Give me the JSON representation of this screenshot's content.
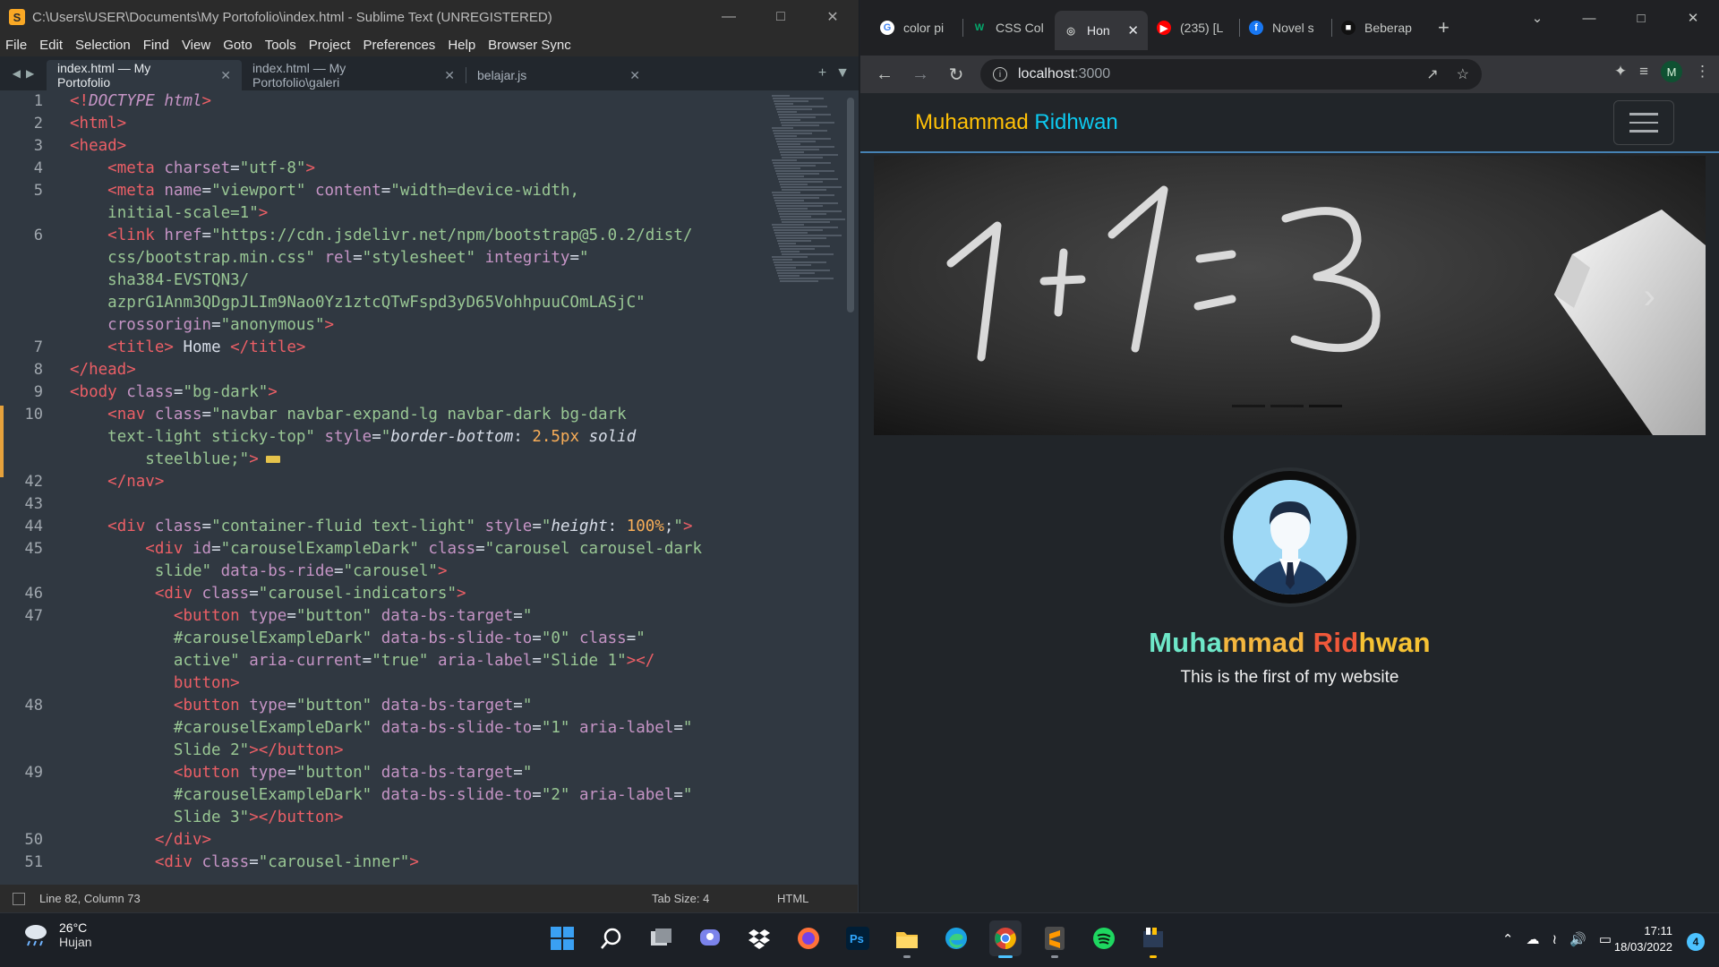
{
  "sublime": {
    "title": "C:\\Users\\USER\\Documents\\My Portofolio\\index.html - Sublime Text (UNREGISTERED)",
    "menu": [
      "File",
      "Edit",
      "Selection",
      "Find",
      "View",
      "Goto",
      "Tools",
      "Project",
      "Preferences",
      "Help",
      "Browser Sync"
    ],
    "tabs": [
      {
        "label": "index.html — My Portofolio"
      },
      {
        "label": "index.html — My Portofolio\\galeri"
      },
      {
        "label": "belajar.js"
      }
    ],
    "line_numbers": [
      "1",
      "2",
      "3",
      "4",
      "5",
      "",
      "6",
      "",
      "",
      "",
      "",
      "7",
      "8",
      "9",
      "10",
      "",
      "",
      "42",
      "43",
      "44",
      "45",
      "",
      "46",
      "47",
      "",
      "",
      "",
      "48",
      "",
      "",
      "49",
      "",
      "",
      "50",
      "51"
    ],
    "lines": [
      {
        "parts": [
          [
            "tg",
            "<!"
          ],
          [
            "kw",
            "DOCTYPE"
          ],
          [
            "tg",
            " "
          ],
          [
            "kw",
            "html"
          ],
          [
            "tg",
            ">"
          ]
        ]
      },
      {
        "parts": [
          [
            "tg",
            "<html>"
          ]
        ]
      },
      {
        "parts": [
          [
            "tg",
            "<head>"
          ]
        ]
      },
      {
        "parts": [
          [
            "pad",
            "    "
          ],
          [
            "tg",
            "<meta "
          ],
          [
            "at",
            "charset"
          ],
          [
            "eq",
            "="
          ],
          [
            "st",
            "\"utf-8\""
          ],
          [
            "tg",
            ">"
          ]
        ]
      },
      {
        "parts": [
          [
            "pad",
            "    "
          ],
          [
            "tg",
            "<meta "
          ],
          [
            "at",
            "name"
          ],
          [
            "eq",
            "="
          ],
          [
            "st",
            "\"viewport\""
          ],
          [
            "eq",
            " "
          ],
          [
            "at",
            "content"
          ],
          [
            "eq",
            "="
          ],
          [
            "st",
            "\"width=device-width,"
          ]
        ]
      },
      {
        "parts": [
          [
            "pad",
            "    "
          ],
          [
            "st",
            "initial-scale=1\""
          ],
          [
            "tg",
            ">"
          ]
        ]
      },
      {
        "parts": [
          [
            "pad",
            "    "
          ],
          [
            "tg",
            "<link "
          ],
          [
            "at",
            "href"
          ],
          [
            "eq",
            "="
          ],
          [
            "st",
            "\"https://cdn.jsdelivr.net/npm/bootstrap@5.0.2/dist/"
          ]
        ]
      },
      {
        "parts": [
          [
            "pad",
            "    "
          ],
          [
            "st",
            "css/bootstrap.min.css\""
          ],
          [
            "eq",
            " "
          ],
          [
            "at",
            "rel"
          ],
          [
            "eq",
            "="
          ],
          [
            "st",
            "\"stylesheet\""
          ],
          [
            "eq",
            " "
          ],
          [
            "at",
            "integrity"
          ],
          [
            "eq",
            "="
          ],
          [
            "st",
            "\""
          ]
        ]
      },
      {
        "parts": [
          [
            "pad",
            "    "
          ],
          [
            "st",
            "sha384-EVSTQN3/"
          ]
        ]
      },
      {
        "parts": [
          [
            "pad",
            "    "
          ],
          [
            "st",
            "azprG1Anm3QDgpJLIm9Nao0Yz1ztcQTwFspd3yD65VohhpuuCOmLASjC\""
          ]
        ]
      },
      {
        "parts": [
          [
            "pad",
            "    "
          ],
          [
            "at",
            "crossorigin"
          ],
          [
            "eq",
            "="
          ],
          [
            "st",
            "\"anonymous\""
          ],
          [
            "tg",
            ">"
          ]
        ]
      },
      {
        "parts": [
          [
            "pad",
            "    "
          ],
          [
            "tg",
            "<title>"
          ],
          [
            "eq",
            " Home "
          ],
          [
            "tg",
            "</title>"
          ]
        ]
      },
      {
        "parts": [
          [
            "tg",
            "</head>"
          ]
        ]
      },
      {
        "parts": [
          [
            "tg",
            "<body "
          ],
          [
            "at",
            "class"
          ],
          [
            "eq",
            "="
          ],
          [
            "st",
            "\"bg-dark\""
          ],
          [
            "tg",
            ">"
          ]
        ]
      },
      {
        "parts": [
          [
            "pad",
            "    "
          ],
          [
            "tg",
            "<nav "
          ],
          [
            "at",
            "class"
          ],
          [
            "eq",
            "="
          ],
          [
            "st",
            "\"navbar navbar-expand-lg navbar-dark bg-dark"
          ]
        ]
      },
      {
        "parts": [
          [
            "pad",
            "    "
          ],
          [
            "st",
            "text-light sticky-top\""
          ],
          [
            "eq",
            " "
          ],
          [
            "at",
            "style"
          ],
          [
            "eq",
            "="
          ],
          [
            "st",
            "\""
          ],
          [
            "prop",
            "border-bottom"
          ],
          [
            "eq",
            ": "
          ],
          [
            "num",
            "2.5px"
          ],
          [
            "eq",
            " "
          ],
          [
            "prop",
            "solid"
          ]
        ]
      },
      {
        "parts": [
          [
            "pad",
            "        "
          ],
          [
            "st",
            "steelblue;\""
          ],
          [
            "tg",
            ">"
          ],
          [
            "fold",
            ""
          ]
        ]
      },
      {
        "parts": [
          [
            "pad",
            "    "
          ],
          [
            "tg",
            "</nav>"
          ]
        ]
      },
      {
        "parts": []
      },
      {
        "parts": [
          [
            "pad",
            "    "
          ],
          [
            "tg",
            "<div "
          ],
          [
            "at",
            "class"
          ],
          [
            "eq",
            "="
          ],
          [
            "st",
            "\"container-fluid text-light\""
          ],
          [
            "eq",
            " "
          ],
          [
            "at",
            "style"
          ],
          [
            "eq",
            "="
          ],
          [
            "st",
            "\""
          ],
          [
            "prop",
            "height"
          ],
          [
            "eq",
            ": "
          ],
          [
            "num",
            "100%"
          ],
          [
            "eq",
            ";"
          ],
          [
            "st",
            "\""
          ],
          [
            "tg",
            ">"
          ]
        ]
      },
      {
        "parts": [
          [
            "pad",
            "        "
          ],
          [
            "tg",
            "<div "
          ],
          [
            "at",
            "id"
          ],
          [
            "eq",
            "="
          ],
          [
            "st",
            "\"carouselExampleDark\""
          ],
          [
            "eq",
            " "
          ],
          [
            "at",
            "class"
          ],
          [
            "eq",
            "="
          ],
          [
            "st",
            "\"carousel carousel-dark"
          ]
        ]
      },
      {
        "parts": [
          [
            "pad",
            "         "
          ],
          [
            "st",
            "slide\""
          ],
          [
            "eq",
            " "
          ],
          [
            "at",
            "data-bs-ride"
          ],
          [
            "eq",
            "="
          ],
          [
            "st",
            "\"carousel\""
          ],
          [
            "tg",
            ">"
          ]
        ]
      },
      {
        "parts": [
          [
            "pad",
            "         "
          ],
          [
            "tg",
            "<div "
          ],
          [
            "at",
            "class"
          ],
          [
            "eq",
            "="
          ],
          [
            "st",
            "\"carousel-indicators\""
          ],
          [
            "tg",
            ">"
          ]
        ]
      },
      {
        "parts": [
          [
            "pad",
            "           "
          ],
          [
            "tg",
            "<button "
          ],
          [
            "at",
            "type"
          ],
          [
            "eq",
            "="
          ],
          [
            "st",
            "\"button\""
          ],
          [
            "eq",
            " "
          ],
          [
            "at",
            "data-bs-target"
          ],
          [
            "eq",
            "="
          ],
          [
            "st",
            "\""
          ]
        ]
      },
      {
        "parts": [
          [
            "pad",
            "           "
          ],
          [
            "st",
            "#carouselExampleDark\""
          ],
          [
            "eq",
            " "
          ],
          [
            "at",
            "data-bs-slide-to"
          ],
          [
            "eq",
            "="
          ],
          [
            "st",
            "\"0\""
          ],
          [
            "eq",
            " "
          ],
          [
            "at",
            "class"
          ],
          [
            "eq",
            "="
          ],
          [
            "st",
            "\""
          ]
        ]
      },
      {
        "parts": [
          [
            "pad",
            "           "
          ],
          [
            "st",
            "active\""
          ],
          [
            "eq",
            " "
          ],
          [
            "at",
            "aria-current"
          ],
          [
            "eq",
            "="
          ],
          [
            "st",
            "\"true\""
          ],
          [
            "eq",
            " "
          ],
          [
            "at",
            "aria-label"
          ],
          [
            "eq",
            "="
          ],
          [
            "st",
            "\"Slide 1\""
          ],
          [
            "tg",
            "></"
          ]
        ]
      },
      {
        "parts": [
          [
            "pad",
            "           "
          ],
          [
            "tg",
            "button>"
          ]
        ]
      },
      {
        "parts": [
          [
            "pad",
            "           "
          ],
          [
            "tg",
            "<button "
          ],
          [
            "at",
            "type"
          ],
          [
            "eq",
            "="
          ],
          [
            "st",
            "\"button\""
          ],
          [
            "eq",
            " "
          ],
          [
            "at",
            "data-bs-target"
          ],
          [
            "eq",
            "="
          ],
          [
            "st",
            "\""
          ]
        ]
      },
      {
        "parts": [
          [
            "pad",
            "           "
          ],
          [
            "st",
            "#carouselExampleDark\""
          ],
          [
            "eq",
            " "
          ],
          [
            "at",
            "data-bs-slide-to"
          ],
          [
            "eq",
            "="
          ],
          [
            "st",
            "\"1\""
          ],
          [
            "eq",
            " "
          ],
          [
            "at",
            "aria-label"
          ],
          [
            "eq",
            "="
          ],
          [
            "st",
            "\""
          ]
        ]
      },
      {
        "parts": [
          [
            "pad",
            "           "
          ],
          [
            "st",
            "Slide 2\""
          ],
          [
            "tg",
            "></button>"
          ]
        ]
      },
      {
        "parts": [
          [
            "pad",
            "           "
          ],
          [
            "tg",
            "<button "
          ],
          [
            "at",
            "type"
          ],
          [
            "eq",
            "="
          ],
          [
            "st",
            "\"button\""
          ],
          [
            "eq",
            " "
          ],
          [
            "at",
            "data-bs-target"
          ],
          [
            "eq",
            "="
          ],
          [
            "st",
            "\""
          ]
        ]
      },
      {
        "parts": [
          [
            "pad",
            "           "
          ],
          [
            "st",
            "#carouselExampleDark\""
          ],
          [
            "eq",
            " "
          ],
          [
            "at",
            "data-bs-slide-to"
          ],
          [
            "eq",
            "="
          ],
          [
            "st",
            "\"2\""
          ],
          [
            "eq",
            " "
          ],
          [
            "at",
            "aria-label"
          ],
          [
            "eq",
            "="
          ],
          [
            "st",
            "\""
          ]
        ]
      },
      {
        "parts": [
          [
            "pad",
            "           "
          ],
          [
            "st",
            "Slide 3\""
          ],
          [
            "tg",
            "></button>"
          ]
        ]
      },
      {
        "parts": [
          [
            "pad",
            "         "
          ],
          [
            "tg",
            "</div>"
          ]
        ]
      },
      {
        "parts": [
          [
            "pad",
            "         "
          ],
          [
            "tg",
            "<div "
          ],
          [
            "at",
            "class"
          ],
          [
            "eq",
            "="
          ],
          [
            "st",
            "\"carousel-inner\""
          ],
          [
            "tg",
            ">"
          ]
        ]
      }
    ],
    "status": {
      "position": "Line 82, Column 73",
      "tab_size": "Tab Size: 4",
      "syntax": "HTML"
    }
  },
  "chrome": {
    "tabs": [
      {
        "label": "color pi",
        "icon": "google-icon"
      },
      {
        "label": "CSS Col",
        "icon": "w3schools-icon"
      },
      {
        "label": "Hon",
        "icon": "globe-icon",
        "active": true
      },
      {
        "label": "(235) [L",
        "icon": "youtube-icon"
      },
      {
        "label": "Novel s",
        "icon": "facebook-icon"
      },
      {
        "label": "Beberap",
        "icon": "site-icon"
      }
    ],
    "url_host": "localhost",
    "url_port": ":3000",
    "avatar_letter": "M"
  },
  "site": {
    "brand_first": "Muhammad",
    "brand_second": "Ridhwan",
    "carousel_text": "1+1=3",
    "hero_name_parts": [
      {
        "text": "Muha",
        "color": "#6ee7c8"
      },
      {
        "text": "mmad",
        "color": "#f4b63e"
      },
      {
        "text": " ",
        "color": "#ffffff"
      },
      {
        "text": "Rid",
        "color": "#f0583a"
      },
      {
        "text": "hwan",
        "color": "#f6c233"
      }
    ],
    "hero_subtitle": "This is the first of my website",
    "carousel_indicator_active": 3,
    "carousel_indicator_count": 3
  },
  "taskbar": {
    "temp": "26°C",
    "condition": "Hujan",
    "time": "17:11",
    "date": "18/03/2022",
    "notifications": "4"
  }
}
